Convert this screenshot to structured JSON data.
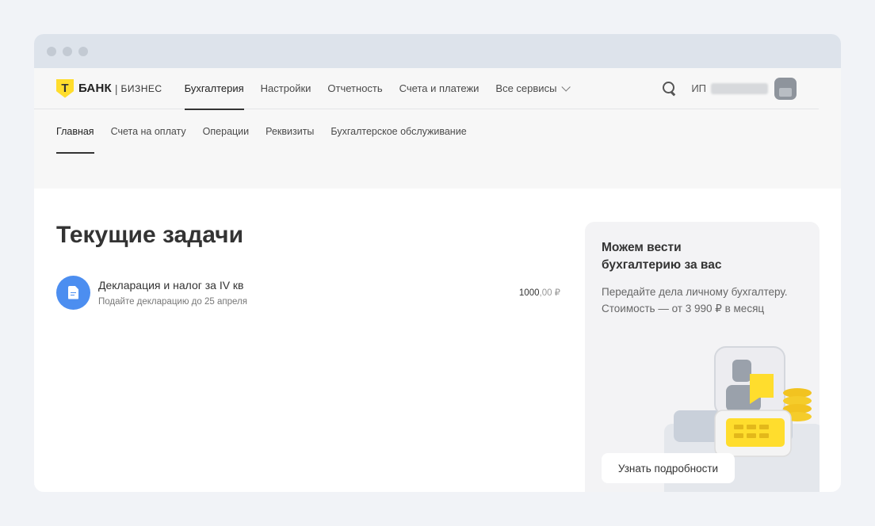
{
  "brand": {
    "logo_letter": "Т",
    "name": "БАНК",
    "separator": "|",
    "subtitle": "БИЗНЕС"
  },
  "topnav": {
    "items": [
      {
        "label": "Бухгалтерия",
        "active": true
      },
      {
        "label": "Настройки",
        "active": false
      },
      {
        "label": "Отчетность",
        "active": false
      },
      {
        "label": "Счета и платежи",
        "active": false
      },
      {
        "label": "Все сервисы",
        "active": false
      }
    ],
    "user_prefix": "ИП"
  },
  "subnav": {
    "items": [
      {
        "label": "Главная",
        "active": true
      },
      {
        "label": "Счета на оплату",
        "active": false
      },
      {
        "label": "Операции",
        "active": false
      },
      {
        "label": "Реквизиты",
        "active": false
      },
      {
        "label": "Бухгалтерское обслуживание",
        "active": false
      }
    ]
  },
  "main": {
    "title": "Текущие задачи",
    "tasks": [
      {
        "title": "Декларация и налог за IV кв",
        "subtitle": "Подайте декларацию до 25 апреля",
        "amount_int": "1000",
        "amount_dec": ",00 ₽"
      }
    ]
  },
  "promo": {
    "title": "Можем вести бухгалтерию за вас",
    "description": "Передайте дела личному бухгалтеру. Стоимость — от 3 990 ₽ в месяц",
    "button_label": "Узнать подробности"
  },
  "colors": {
    "accent_yellow": "#ffdd2d",
    "task_icon_blue": "#4c8ef0",
    "page_bg": "#f1f3f7"
  }
}
